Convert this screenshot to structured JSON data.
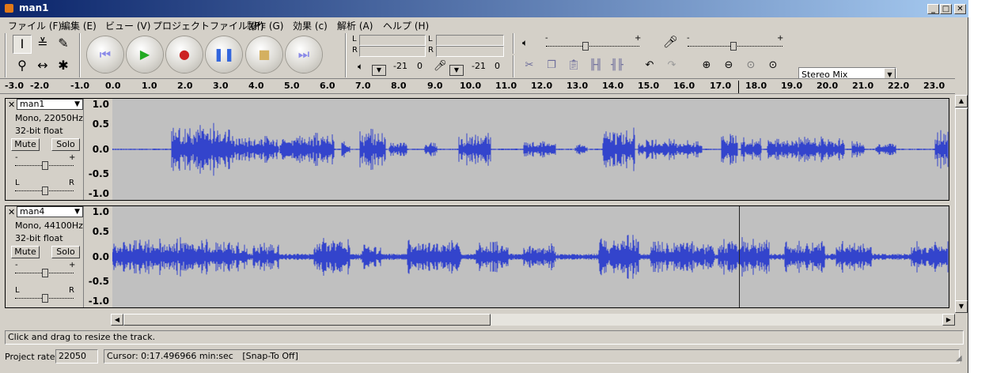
{
  "window": {
    "title": "man1"
  },
  "menu": [
    "ファイル (F)",
    "編集 (E)",
    "ビュー (V)",
    "プロジェクトファイル (P)",
    "製作 (G)",
    "効果 (c)",
    "解析 (A)",
    "ヘルプ (H)"
  ],
  "tools": {
    "select": "I",
    "envelope": "≚",
    "draw": "✎",
    "zoom": "⚲",
    "timeshift": "↔",
    "multi": "✱"
  },
  "meters": {
    "play_db": "-21",
    "play_end": "0",
    "rec_db": "-21",
    "rec_end": "0",
    "L": "L",
    "R": "R"
  },
  "mixer": {
    "input_source": "Stereo Mix",
    "minus": "-",
    "plus": "+"
  },
  "ruler": [
    "-3.0",
    "-2.0",
    "-1.0",
    "0.0",
    "1.0",
    "2.0",
    "3.0",
    "4.0",
    "5.0",
    "6.0",
    "7.0",
    "8.0",
    "9.0",
    "10.0",
    "11.0",
    "12.0",
    "13.0",
    "14.0",
    "15.0",
    "16.0",
    "17.0",
    "18.0",
    "19.0",
    "20.0",
    "21.0",
    "22.0",
    "23.0"
  ],
  "tracks": [
    {
      "name": "man1",
      "info1": "Mono, 22050Hz",
      "info2": "32-bit float",
      "mute": "Mute",
      "solo": "Solo",
      "gain_minus": "-",
      "gain_plus": "+",
      "pan_l": "L",
      "pan_r": "R",
      "scale": [
        "1.0",
        "0.5",
        "0.0",
        "-0.5",
        "-1.0"
      ]
    },
    {
      "name": "man4",
      "info1": "Mono, 44100Hz",
      "info2": "32-bit float",
      "mute": "Mute",
      "solo": "Solo",
      "gain_minus": "-",
      "gain_plus": "+",
      "pan_l": "L",
      "pan_r": "R",
      "scale": [
        "1.0",
        "0.5",
        "0.0",
        "-0.5",
        "-1.0"
      ]
    }
  ],
  "status": {
    "hint": "Click and drag to resize the track.",
    "project_rate_label": "Project rate:",
    "project_rate": "22050",
    "cursor": "Cursor: 0:17.496966 min:sec",
    "snap": "[Snap-To Off]"
  },
  "colors": {
    "waveform": "#3344cc",
    "track_bg": "#c0c0c0",
    "chrome": "#d4d0c8",
    "title_start": "#0a246a",
    "title_end": "#a6caf0"
  }
}
